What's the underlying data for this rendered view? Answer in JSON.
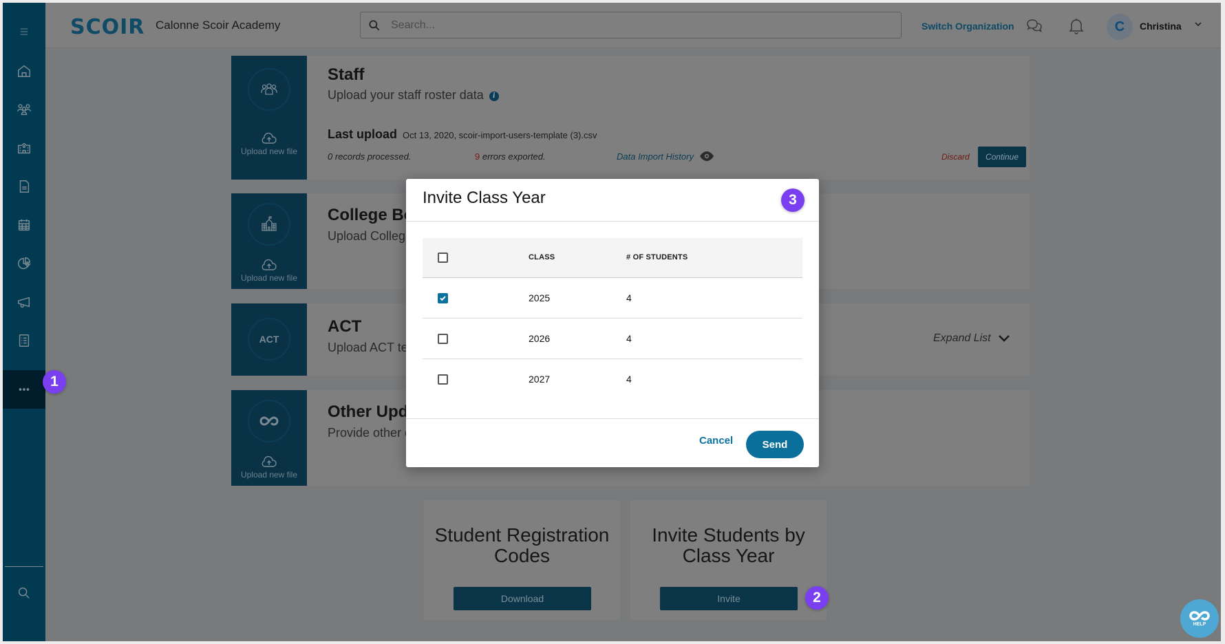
{
  "header": {
    "logo": "SCOIR",
    "org_name": "Calonne Scoir Academy",
    "search_placeholder": "Search...",
    "switch_org": "Switch Organization",
    "avatar_initial": "C",
    "user_name": "Christina"
  },
  "sidebar": {
    "items": [
      {
        "icon": "menu-icon"
      },
      {
        "icon": "home-icon"
      },
      {
        "icon": "students-icon"
      },
      {
        "icon": "school-icon"
      },
      {
        "icon": "document-icon"
      },
      {
        "icon": "calendar-icon"
      },
      {
        "icon": "analytics-icon"
      },
      {
        "icon": "megaphone-icon"
      },
      {
        "icon": "checklist-icon"
      },
      {
        "icon": "more-icon",
        "active": true
      },
      {
        "icon": "search-icon"
      }
    ]
  },
  "cards": {
    "staff": {
      "title": "Staff",
      "subtitle": "Upload your staff roster data",
      "upload_label": "Upload new file",
      "last_upload_label": "Last upload",
      "last_upload_value": "Oct 13, 2020, scoir-import-users-template (3).csv",
      "records_count": "0",
      "records_text": "records processed.",
      "errors_count": "9",
      "errors_text": "errors exported.",
      "history_link": "Data Import History",
      "discard": "Discard",
      "continue": "Continue"
    },
    "college_board": {
      "title": "College Board",
      "subtitle": "Upload College Board test scores",
      "upload_label": "Upload new file"
    },
    "act": {
      "title": "ACT",
      "subtitle": "Upload ACT test scores",
      "circle_text": "ACT",
      "expand": "Expand List"
    },
    "other": {
      "title": "Other Updates",
      "subtitle": "Provide other data for Scoir to upload on your behalf",
      "upload_label": "Upload new file"
    }
  },
  "tiles": [
    {
      "title": "Student Registration Codes",
      "button": "Download"
    },
    {
      "title": "Invite Students by Class Year",
      "button": "Invite"
    }
  ],
  "modal": {
    "title": "Invite Class Year",
    "columns": [
      "CLASS",
      "# OF STUDENTS"
    ],
    "rows": [
      {
        "class": "2025",
        "students": "4",
        "checked": true
      },
      {
        "class": "2026",
        "students": "4",
        "checked": false
      },
      {
        "class": "2027",
        "students": "4",
        "checked": false
      }
    ],
    "cancel": "Cancel",
    "send": "Send"
  },
  "step_badges": [
    "1",
    "2",
    "3"
  ],
  "help": {
    "label": "HELP"
  },
  "colors": {
    "brand": "#0b6f9c",
    "sidebar": "#023a52",
    "step_badge": "#7b3ff2",
    "help": "#4fa8d4",
    "error": "#7a1c10"
  }
}
